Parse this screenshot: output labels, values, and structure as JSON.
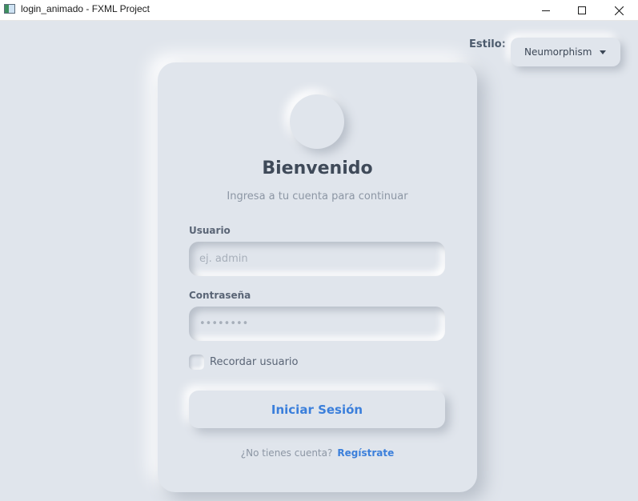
{
  "window": {
    "title": "login_animado - FXML Project"
  },
  "style_selector": {
    "label": "Estilo:",
    "selected": "Neumorphism"
  },
  "card": {
    "heading": "Bienvenido",
    "subtitle": "Ingresa a tu cuenta para continuar",
    "username": {
      "label": "Usuario",
      "placeholder": "ej. admin",
      "value": ""
    },
    "password": {
      "label": "Contraseña",
      "placeholder": "••••••••",
      "value": ""
    },
    "remember": {
      "label": "Recordar usuario",
      "checked": false
    },
    "login_button": "Iniciar Sesión",
    "register": {
      "question": "¿No tienes cuenta?",
      "link": "Regístrate"
    }
  },
  "colors": {
    "background": "#e0e5ec",
    "accent": "#3b7fdb",
    "text": "#3f4a59",
    "muted": "#8c96a4"
  },
  "icons": {
    "app": "window-icon",
    "minimize": "minimize-icon",
    "maximize": "maximize-icon",
    "close": "close-icon",
    "dropdown": "chevron-down-icon"
  }
}
